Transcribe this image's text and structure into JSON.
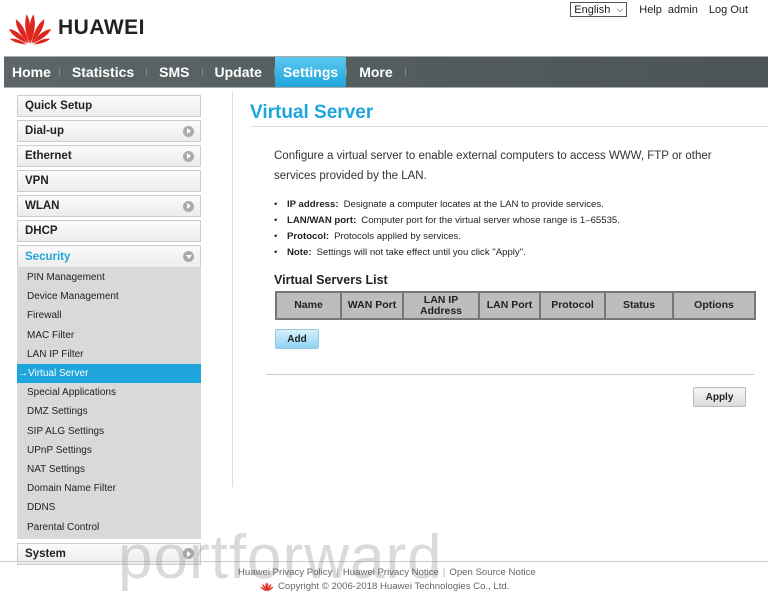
{
  "header": {
    "brand": "HUAWEI",
    "language": "English",
    "links": [
      "Help",
      "admin",
      "Log Out"
    ]
  },
  "nav": {
    "items": [
      "Home",
      "Statistics",
      "SMS",
      "Update",
      "Settings",
      "More"
    ],
    "active": "Settings"
  },
  "sidebar": {
    "sections": [
      {
        "label": "Quick Setup",
        "icon": "none"
      },
      {
        "label": "Dial-up",
        "icon": "expand-arrow-icon"
      },
      {
        "label": "Ethernet",
        "icon": "expand-arrow-icon"
      },
      {
        "label": "VPN",
        "icon": "none"
      },
      {
        "label": "WLAN",
        "icon": "expand-arrow-icon"
      },
      {
        "label": "DHCP",
        "icon": "none"
      },
      {
        "label": "Security",
        "icon": "collapse-arrow-icon",
        "open": true
      },
      {
        "label": "System",
        "icon": "expand-arrow-icon"
      }
    ],
    "security_items": [
      "PIN Management",
      "Device Management",
      "Firewall",
      "MAC Filter",
      "LAN IP Filter",
      "→Virtual Server",
      "Special Applications",
      "DMZ Settings",
      "SIP ALG Settings",
      "UPnP Settings",
      "NAT Settings",
      "Domain Name Filter",
      "DDNS",
      "Parental Control"
    ],
    "active_item": "Virtual Server"
  },
  "main": {
    "title": "Virtual Server",
    "description": "Configure a virtual server to enable external computers to access WWW, FTP or other services provided by the LAN.",
    "bullets": [
      {
        "term": "IP address:",
        "text": "Designate a computer locates at the LAN to provide services."
      },
      {
        "term": "LAN/WAN port:",
        "text": "Computer port for the virtual server whose range is 1–65535."
      },
      {
        "term": "Protocol:",
        "text": "Protocols applied by services."
      },
      {
        "term": "Note:",
        "text": "Settings will not take effect until you click \"Apply\"."
      }
    ],
    "list_title": "Virtual Servers List",
    "table_headers": [
      "Name",
      "WAN Port",
      "LAN IP Address",
      "LAN Port",
      "Protocol",
      "Status",
      "Options"
    ],
    "table_rows": [],
    "add_label": "Add",
    "apply_label": "Apply"
  },
  "footer": {
    "links": [
      "Huawei Privacy Policy",
      "Huawei Privacy Notice",
      "Open Source Notice"
    ],
    "copyright": "Copyright © 2006-2018 Huawei Technologies Co., Ltd."
  },
  "watermark": "portforward",
  "colors": {
    "accent": "#1ea5dc",
    "nav_bg": "#555e60",
    "brand_red": "#e0261c"
  }
}
